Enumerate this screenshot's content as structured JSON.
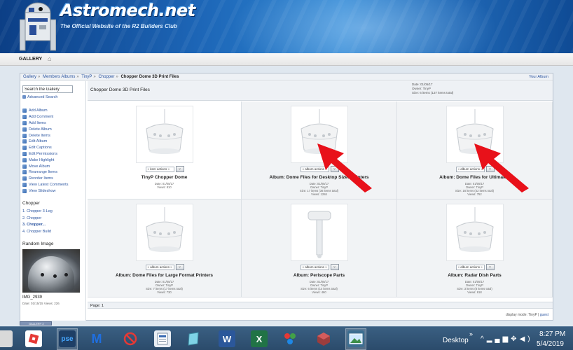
{
  "site": {
    "title": "Astromech.net",
    "tagline": "The Official Website of the R2 Builders Club"
  },
  "nav": {
    "gallery_label": "GALLERY",
    "home_icon": "home-icon"
  },
  "breadcrumb": {
    "items": [
      "Gallery",
      "Members Albums",
      "TinyP",
      "Chopper"
    ],
    "current": "Chopper Dome 3D Print Files",
    "your_album": "Your Album"
  },
  "sidebar": {
    "search_value": "Search the Gallery",
    "advanced_search": "Advanced Search",
    "actions": [
      "Add Album",
      "Add Comment",
      "Add Items",
      "Delete Album",
      "Delete Items",
      "Edit Album",
      "Edit Captions",
      "Edit Permissions",
      "Make Highlight",
      "Move Album",
      "Rearrange Items",
      "Reorder Items",
      "View Latest Comments",
      "View Slideshow"
    ],
    "chopper_title": "Chopper",
    "chopper_items": [
      "1. Chopper 3-Leg",
      "2. Chopper",
      "3. Chopper...",
      "4. Chopper Build"
    ],
    "random_title": "Random Image",
    "random_caption": "IMG_2939",
    "random_meta": "Date: 01/15/15  Views: 226"
  },
  "album": {
    "title": "Chopper Dome 3D Print Files",
    "meta": [
      "Date: 01/05/17",
      "Owner: TinyP",
      "Size: 6 items (137 items total)"
    ]
  },
  "grid": [
    {
      "title": "TinyP Chopper Dome",
      "actions": "« item actions »",
      "meta": [
        "Date: 01/05/17",
        "Views: 810"
      ]
    },
    {
      "title": "Album: Dome Files for Desktop Sized Printers",
      "actions": "« album actions »",
      "meta": [
        "Date: 01/05/17",
        "Owner: TinyP",
        "Size: 17 items (36 items total)",
        "Views: 1284"
      ]
    },
    {
      "title": "Album: Dome Files for Ultimaker",
      "actions": "« album actions »",
      "meta": [
        "Date: 01/05/17",
        "Owner: TinyP",
        "Size: 16 items (42 items total)",
        "Views: 752"
      ]
    },
    {
      "title": "Album: Dome Files for Large Format Printers",
      "actions": "« album actions »",
      "meta": [
        "Date: 01/05/17",
        "Owner: TinyP",
        "Size: 7 items (17 items total)",
        "Views: 730"
      ]
    },
    {
      "title": "Album: Periscope Parts",
      "actions": "« album actions »",
      "meta": [
        "Date: 01/05/17",
        "Owner: TinyP",
        "Size: 6 items (14 items total)",
        "Views: 460"
      ]
    },
    {
      "title": "Album: Radar Dish Parts",
      "actions": "« album actions »",
      "meta": [
        "Date: 01/05/17",
        "Owner: TinyP",
        "Size: 3 items (8 items total)",
        "Views: 618"
      ]
    }
  ],
  "pager": {
    "label": "Page: 1"
  },
  "display_mode": {
    "prefix": "display mode: TinyP |",
    "user": "guest"
  },
  "gallery_badge": "GALLERY 2",
  "taskbar": {
    "desktop_label": "Desktop",
    "time": "8:27 PM",
    "date": "5/4/2019",
    "apps": [
      "roblox-icon",
      "pse-icon",
      "malwarebytes-icon",
      "blocked-icon",
      "word-doc-icon",
      "notepad-icon",
      "word-icon",
      "excel-icon",
      "paint-icon",
      "cube-icon",
      "photos-icon"
    ]
  }
}
